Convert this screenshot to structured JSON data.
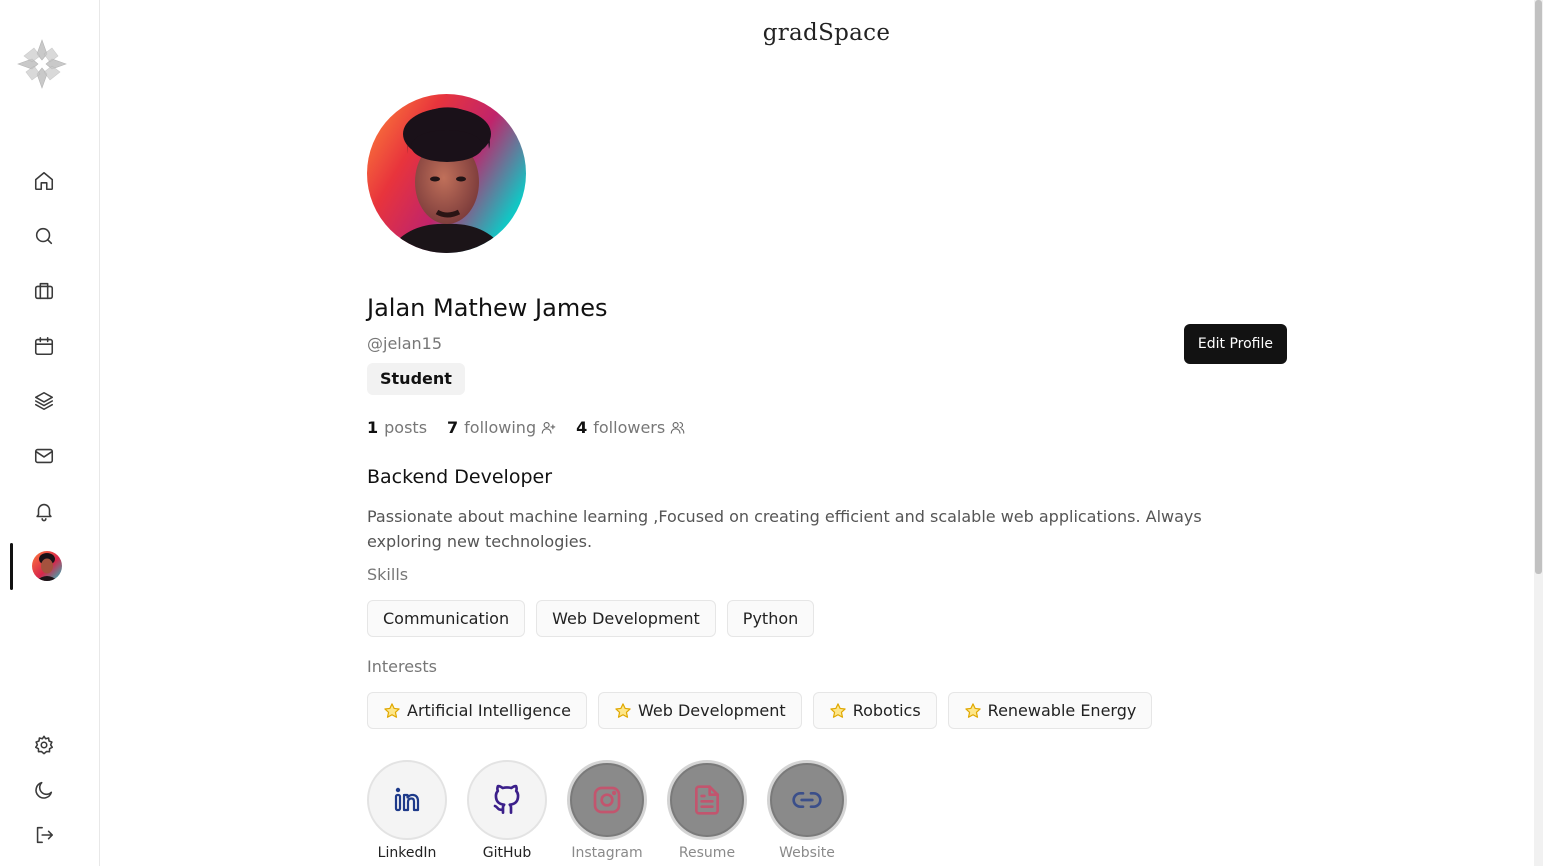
{
  "app": {
    "brand": "gradSpace"
  },
  "sidebar": {
    "items": [
      {
        "name": "home"
      },
      {
        "name": "search"
      },
      {
        "name": "jobs"
      },
      {
        "name": "calendar"
      },
      {
        "name": "layers"
      },
      {
        "name": "messages"
      },
      {
        "name": "notifications"
      },
      {
        "name": "profile",
        "active": true
      }
    ],
    "bottom_items": [
      {
        "name": "settings"
      },
      {
        "name": "theme"
      },
      {
        "name": "logout"
      }
    ]
  },
  "profile": {
    "name": "Jalan Mathew James",
    "handle": "@jelan15",
    "role": "Student",
    "edit_label": "Edit Profile",
    "stats": {
      "posts_count": "1",
      "posts_label": "posts",
      "following_count": "7",
      "following_label": "following",
      "followers_count": "4",
      "followers_label": "followers"
    },
    "headline": "Backend Developer",
    "bio": "Passionate about machine learning ,Focused on creating efficient and scalable web applications. Always exploring new technologies.",
    "skills_title": "Skills",
    "skills": [
      "Communication",
      "Web Development",
      "Python"
    ],
    "interests_title": "Interests",
    "interests": [
      "Artificial Intelligence",
      "Web Development",
      "Robotics",
      "Renewable Energy"
    ],
    "socials": [
      {
        "label": "LinkedIn",
        "icon": "linkedin-icon",
        "enabled": true,
        "color": "#1e3a8a"
      },
      {
        "label": "GitHub",
        "icon": "github-icon",
        "enabled": true,
        "color": "#3b1f8a"
      },
      {
        "label": "Instagram",
        "icon": "instagram-icon",
        "enabled": false,
        "color": "#c2556e"
      },
      {
        "label": "Resume",
        "icon": "file-icon",
        "enabled": false,
        "color": "#c2556e"
      },
      {
        "label": "Website",
        "icon": "link-icon",
        "enabled": false,
        "color": "#3b4f8a"
      }
    ]
  },
  "colors": {
    "accent_dark": "#121212",
    "star": "#f5c518",
    "muted": "#777777"
  }
}
